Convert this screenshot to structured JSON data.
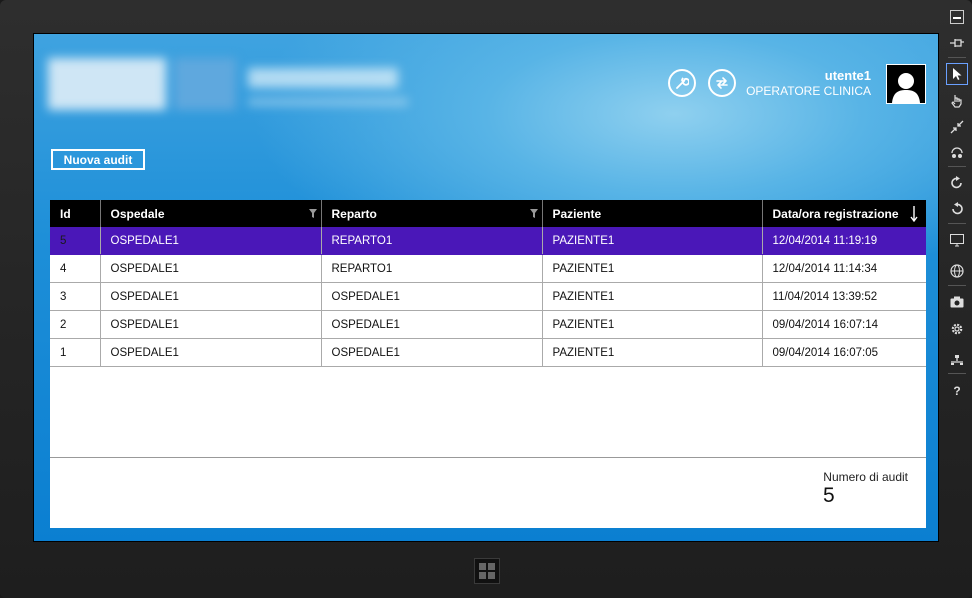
{
  "app": {
    "brand_color": "#1e8fd8",
    "selection_color": "#4a17b8"
  },
  "header": {
    "user_name": "utente1",
    "user_role": "OPERATORE CLINICA",
    "tools_icon": "wrench-icon",
    "sync_icon": "swap-arrows-icon",
    "avatar_icon": "user-silhouette-icon"
  },
  "toolbar": {
    "new_audit_label": "Nuova audit"
  },
  "table": {
    "columns": [
      {
        "label": "Id"
      },
      {
        "label": "Ospedale",
        "filter": true
      },
      {
        "label": "Reparto",
        "filter": true
      },
      {
        "label": "Paziente"
      },
      {
        "label": "Data/ora registrazione",
        "sort": "descending"
      }
    ],
    "rows": [
      {
        "id": "5",
        "ospedale": "OSPEDALE1",
        "reparto": "REPARTO1",
        "paziente": "PAZIENTE1",
        "data": "12/04/2014 11:19:19",
        "selected": true
      },
      {
        "id": "4",
        "ospedale": "OSPEDALE1",
        "reparto": "REPARTO1",
        "paziente": "PAZIENTE1",
        "data": "12/04/2014 11:14:34"
      },
      {
        "id": "3",
        "ospedale": "OSPEDALE1",
        "reparto": "OSPEDALE1",
        "paziente": "PAZIENTE1",
        "data": "11/04/2014 13:39:52"
      },
      {
        "id": "2",
        "ospedale": "OSPEDALE1",
        "reparto": "OSPEDALE1",
        "paziente": "PAZIENTE1",
        "data": "09/04/2014 16:07:14"
      },
      {
        "id": "1",
        "ospedale": "OSPEDALE1",
        "reparto": "OSPEDALE1",
        "paziente": "PAZIENTE1",
        "data": "09/04/2014 16:07:05"
      }
    ]
  },
  "footer": {
    "count_label": "Numero di audit",
    "count_value": "5"
  },
  "simulator_sidebar": {
    "help_label": "?",
    "items": [
      "minimize-icon",
      "pin-icon",
      "mouse-mode-icon",
      "touch-mode-icon",
      "pinch-zoom-icon",
      "rotate-touch-icon",
      "rotate-clockwise-icon",
      "rotate-counterclockwise-icon",
      "resolution-icon",
      "location-icon",
      "screenshot-icon",
      "settings-icon",
      "network-icon",
      "help-icon"
    ]
  },
  "taskbar": {
    "start_icon": "windows-logo-icon"
  }
}
